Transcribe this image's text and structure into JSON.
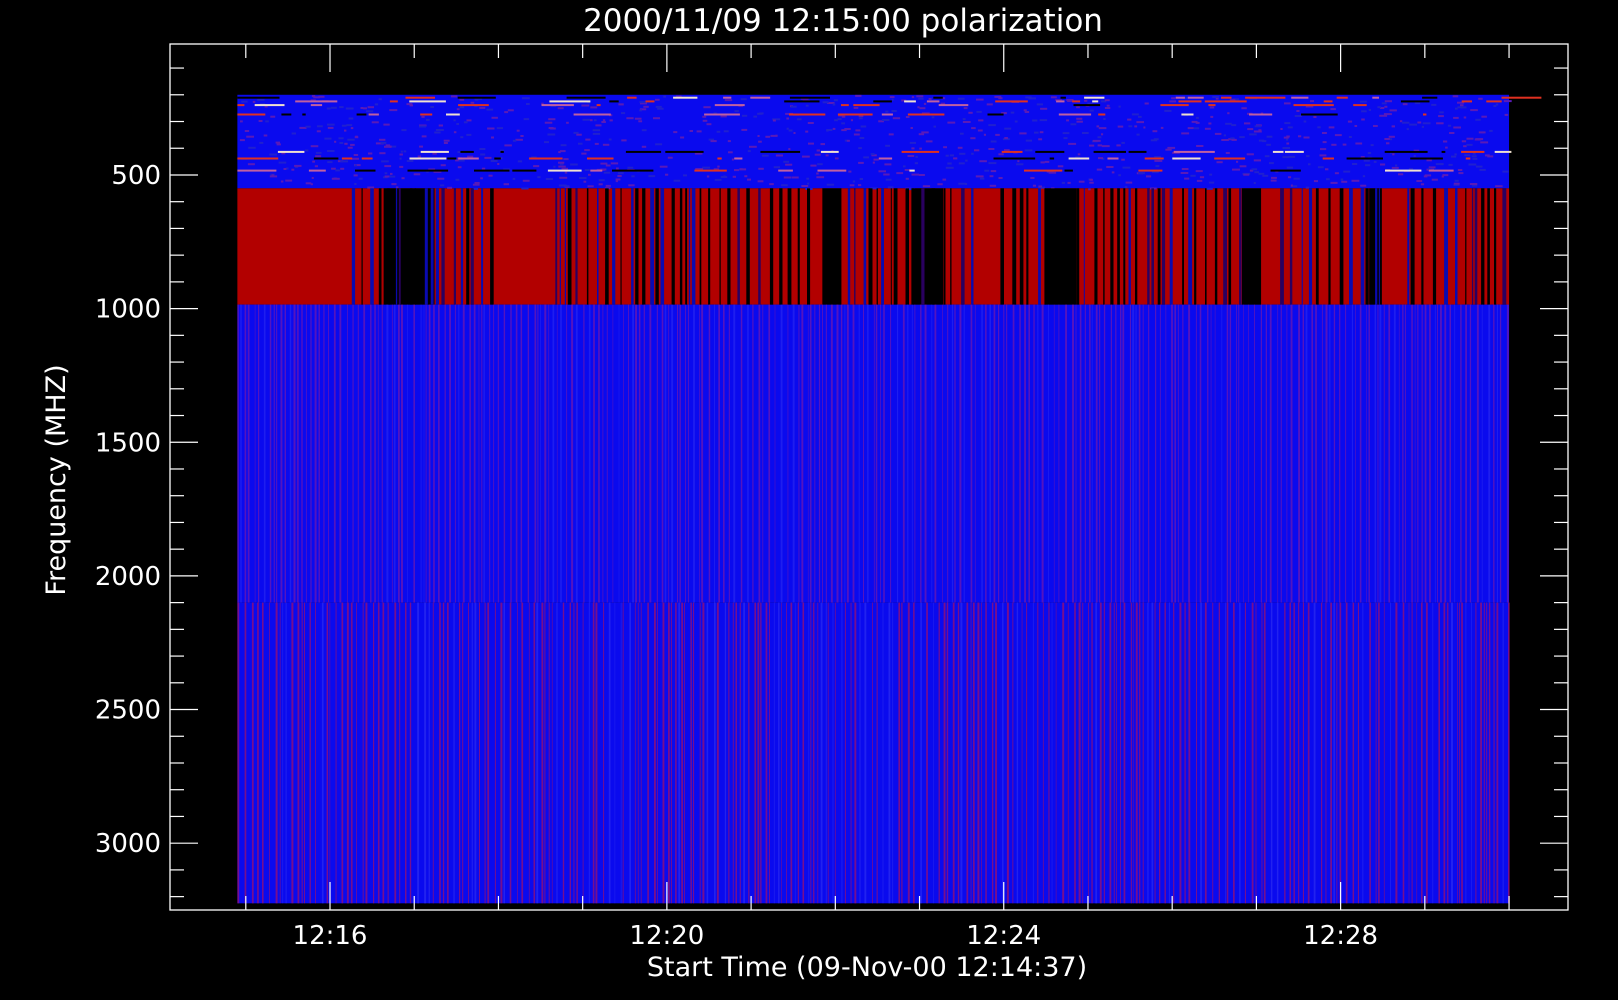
{
  "chart_data": {
    "type": "heatmap",
    "title": "2000/11/09 12:15:00 polarization",
    "xlabel": "Start Time (09-Nov-00 12:14:37)",
    "ylabel": "Frequency (MHZ)",
    "x_ticks": [
      "12:16",
      "12:20",
      "12:24",
      "12:28"
    ],
    "y_ticks": [
      "500",
      "1000",
      "1500",
      "2000",
      "2500",
      "3000"
    ],
    "x_tick_minutes": [
      16,
      20,
      24,
      28
    ],
    "y_tick_values": [
      500,
      1000,
      1500,
      2000,
      2500,
      3000
    ],
    "xlim_minutes_after_12h": [
      14.1,
      30.7
    ],
    "ylim_mhz": [
      3250,
      10
    ],
    "data_time_range_minutes_after_12h": [
      14.9,
      30.0
    ],
    "frequency_bands_mhz": [
      {
        "range": [
          200,
          550
        ],
        "appearance": "noisy blue with red and white horizontal streaks"
      },
      {
        "range": [
          550,
          985
        ],
        "appearance": "alternating red and black vertical stripes"
      },
      {
        "range": [
          985,
          2100
        ],
        "appearance": "blue with purple vertical striations"
      },
      {
        "range": [
          2100,
          3225
        ],
        "appearance": "blue with fine red vertical striations"
      }
    ],
    "colors": {
      "background": "#000000",
      "axis": "#ffffff",
      "blue": "#0a0aee",
      "red": "#b20000",
      "purple": "#6a14b0",
      "black": "#000000"
    }
  }
}
